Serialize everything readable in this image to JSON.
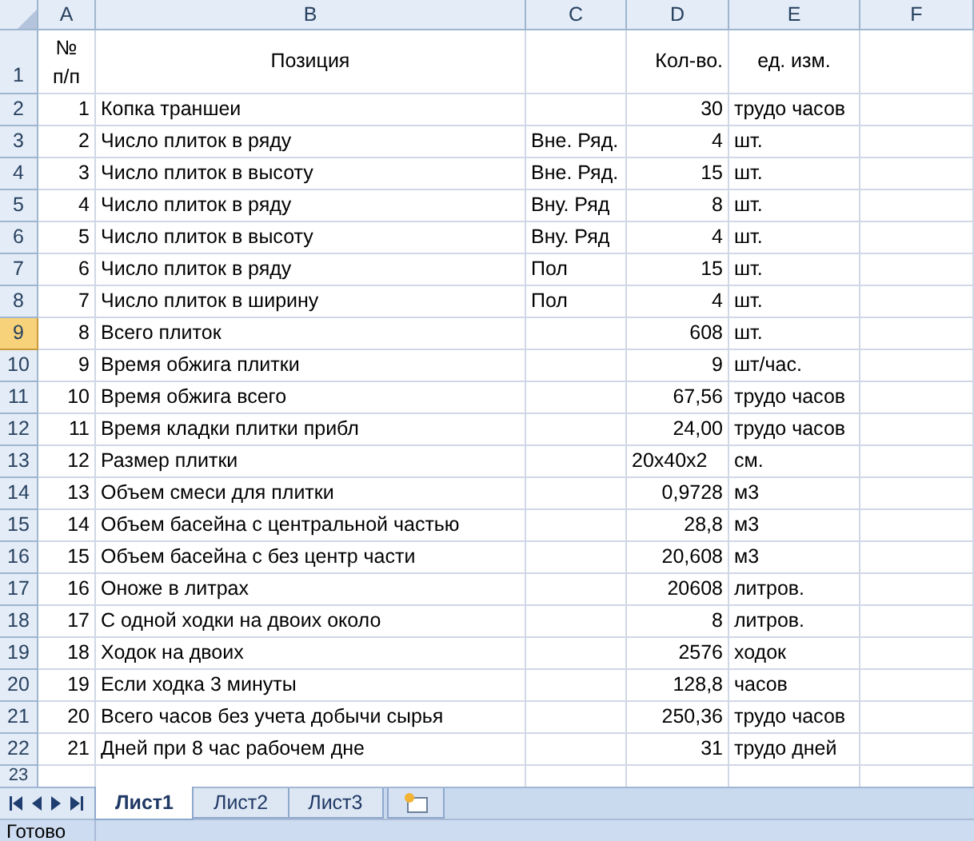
{
  "columns": [
    "A",
    "B",
    "C",
    "D",
    "E",
    "F"
  ],
  "header_row": {
    "number": "1",
    "a": "№\nп/п",
    "b": "Позиция",
    "d": "Кол-во.",
    "e": "ед. изм."
  },
  "rows": [
    {
      "number": "2",
      "a": "1",
      "b": "Копка траншеи",
      "d": "30",
      "d_text": false,
      "e": "трудо часов",
      "selected": false
    },
    {
      "number": "3",
      "a": "2",
      "b": "Число плиток в ряду",
      "c": "Вне. Ряд.",
      "d": "4",
      "d_text": false,
      "e": "шт.",
      "selected": false
    },
    {
      "number": "4",
      "a": "3",
      "b": "Число плиток в высоту",
      "c": "Вне. Ряд.",
      "d": "15",
      "d_text": false,
      "e": "шт.",
      "selected": false
    },
    {
      "number": "5",
      "a": "4",
      "b": "Число плиток в ряду",
      "c": "Вну. Ряд",
      "d": "8",
      "d_text": false,
      "e": "шт.",
      "selected": false
    },
    {
      "number": "6",
      "a": "5",
      "b": "Число плиток в высоту",
      "c": "Вну. Ряд",
      "d": "4",
      "d_text": false,
      "e": "шт.",
      "selected": false
    },
    {
      "number": "7",
      "a": "6",
      "b": "Число плиток в ряду",
      "c": "Пол",
      "d": "15",
      "d_text": false,
      "e": "шт.",
      "selected": false
    },
    {
      "number": "8",
      "a": "7",
      "b": "Число плиток в ширину",
      "c": "Пол",
      "d": "4",
      "d_text": false,
      "e": "шт.",
      "selected": false
    },
    {
      "number": "9",
      "a": "8",
      "b": "Всего плиток",
      "d": "608",
      "d_text": false,
      "e": "шт.",
      "selected": true
    },
    {
      "number": "10",
      "a": "9",
      "b": "Время обжига плитки",
      "d": "9",
      "d_text": false,
      "e": "шт/час.",
      "selected": false
    },
    {
      "number": "11",
      "a": "10",
      "b": "Время обжига всего",
      "d": "67,56",
      "d_text": false,
      "e": "трудо часов",
      "selected": false
    },
    {
      "number": "12",
      "a": "11",
      "b": "Время кладки плитки прибл",
      "d": "24,00",
      "d_text": false,
      "e": "трудо часов",
      "selected": false
    },
    {
      "number": "13",
      "a": "12",
      "b": "Размер плитки",
      "d": "20x40x2",
      "d_text": true,
      "e": "см.",
      "selected": false
    },
    {
      "number": "14",
      "a": "13",
      "b": "Объем смеси для плитки",
      "d": "0,9728",
      "d_text": false,
      "e": "м3",
      "selected": false
    },
    {
      "number": "15",
      "a": "14",
      "b": "Объем басейна с центральной частью",
      "d": "28,8",
      "d_text": false,
      "e": "м3",
      "selected": false
    },
    {
      "number": "16",
      "a": "15",
      "b": "Объем басейна с без центр части",
      "d": "20,608",
      "d_text": false,
      "e": "м3",
      "selected": false
    },
    {
      "number": "17",
      "a": "16",
      "b": "Оноже в литрах",
      "d": "20608",
      "d_text": false,
      "e": "литров.",
      "selected": false
    },
    {
      "number": "18",
      "a": "17",
      "b": "С одной ходки на двоих около",
      "d": "8",
      "d_text": false,
      "e": "литров.",
      "selected": false
    },
    {
      "number": "19",
      "a": "18",
      "b": "Ходок на двоих",
      "d": "2576",
      "d_text": false,
      "e": "ходок",
      "selected": false
    },
    {
      "number": "20",
      "a": "19",
      "b": "Если ходка 3 минуты",
      "d": "128,8",
      "d_text": false,
      "e": "часов",
      "selected": false
    },
    {
      "number": "21",
      "a": "20",
      "b": "Всего часов без учета добычи сырья",
      "d": "250,36",
      "d_text": false,
      "e": "трудо часов",
      "selected": false
    },
    {
      "number": "22",
      "a": "21",
      "b": "Дней при 8 час рабочем дне",
      "d": "31",
      "d_text": false,
      "e": "трудо дней",
      "selected": false
    }
  ],
  "partial_row": {
    "number": "23"
  },
  "sheet_tabs": [
    {
      "label": "Лист1",
      "selected": true
    },
    {
      "label": "Лист2",
      "selected": false
    },
    {
      "label": "Лист3",
      "selected": false
    }
  ],
  "status_bar": {
    "text": "Готово"
  }
}
